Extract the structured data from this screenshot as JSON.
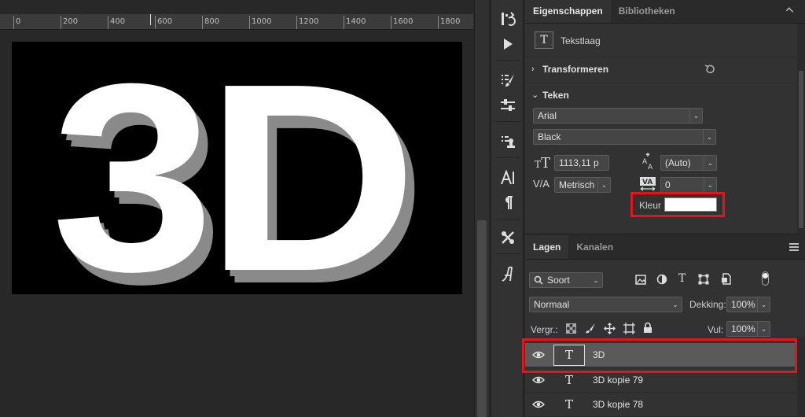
{
  "ruler": {
    "labels": [
      "0",
      "200",
      "400",
      "600",
      "800",
      "1000",
      "1200",
      "1400",
      "1600",
      "1800"
    ]
  },
  "canvas": {
    "text": "3D",
    "text_color": "#ffffff",
    "shadow_color": "#8a8a8a",
    "background": "#000000"
  },
  "tools": [
    "history-icon",
    "play-icon",
    "brush-settings-icon",
    "adjust-icon",
    "clone-source-icon",
    "character-icon",
    "paragraph-icon",
    "tool-presets-icon",
    "glyphs-icon"
  ],
  "properties": {
    "tabs": [
      "Eigenschappen",
      "Bibliotheken"
    ],
    "layer_type": "Tekstlaag",
    "transform_label": "Transformeren",
    "type_label": "Teken",
    "font_family": "Arial",
    "font_style": "Black",
    "font_size": "1113,11 p",
    "leading": "(Auto)",
    "kerning": "Metrisch",
    "tracking": "0",
    "color_label": "Kleur",
    "color_value": "#ffffff"
  },
  "layers": {
    "tabs": [
      "Lagen",
      "Kanalen"
    ],
    "filter": "Soort",
    "blend_mode": "Normaal",
    "opacity_label": "Dekking:",
    "opacity_value": "100%",
    "lock_label": "Vergr.:",
    "fill_label": "Vul:",
    "fill_value": "100%",
    "items": [
      {
        "name": "3D",
        "selected": true
      },
      {
        "name": "3D kopie 79",
        "selected": false
      },
      {
        "name": "3D kopie 78",
        "selected": false
      }
    ]
  },
  "highlight_color": "#e4141b"
}
